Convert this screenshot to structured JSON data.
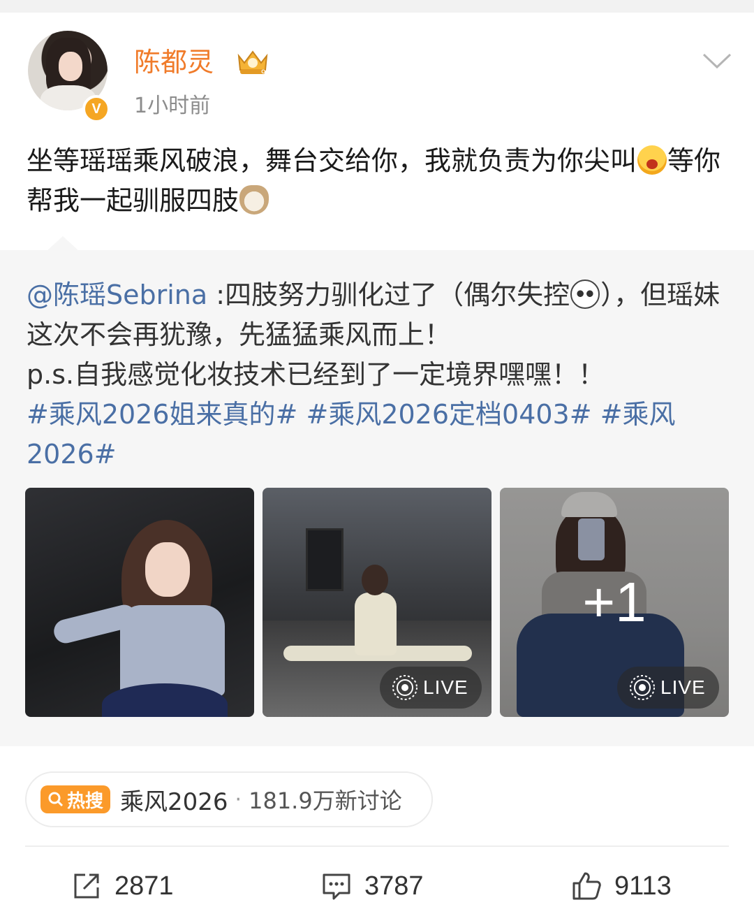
{
  "post": {
    "author": "陈都灵",
    "time": "1小时前",
    "text_part1": "坐等瑶瑶乘风破浪，舞台交给你，我就负责为你尖叫",
    "text_part2": "等你帮我一起驯服四肢",
    "avatar_badge": "V"
  },
  "repost": {
    "mention": "@陈瑶Sebrina",
    "text_part1": " :四肢努力驯化过了（偶尔失控",
    "text_part2": "），但瑶妹这次不会再犹豫，先猛猛乘风而上！",
    "text_part3": "p.s.自我感觉化妆技术已经到了一定境界嘿嘿！！",
    "hashtags": [
      "#乘风2026姐来真的#",
      "#乘风2026定档0403#",
      "#乘风2026#"
    ],
    "photos": {
      "extra_count_label": "+1",
      "live_label": "LIVE"
    }
  },
  "hot_search": {
    "badge": "热搜",
    "topic": "乘风2026",
    "separator": "·",
    "count": "181.9万新讨论"
  },
  "actions": {
    "repost_count": "2871",
    "comment_count": "3787",
    "like_count": "9113"
  },
  "colors": {
    "username": "#f07b2a",
    "link": "#4a6fa5",
    "hot_badge": "#fb9a2a"
  }
}
